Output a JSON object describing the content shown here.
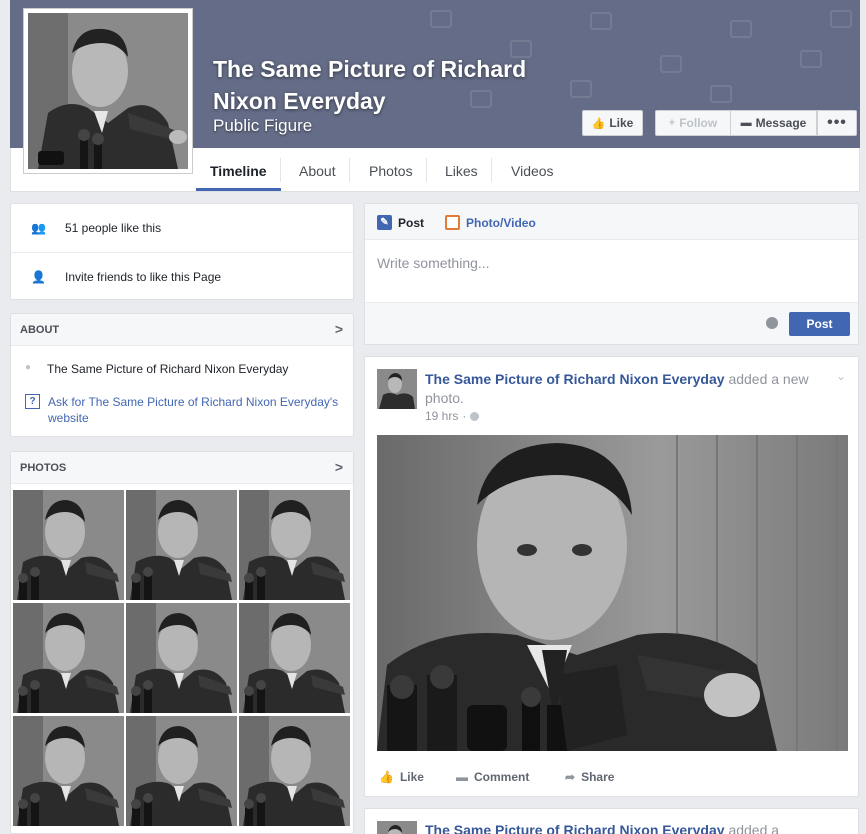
{
  "page": {
    "name": "The Same Picture of Richard Nixon Everyday",
    "category": "Public Figure"
  },
  "header_buttons": {
    "like": "Like",
    "follow": "Follow",
    "message": "Message",
    "more": "•••"
  },
  "tabs": [
    {
      "label": "Timeline",
      "active": true
    },
    {
      "label": "About"
    },
    {
      "label": "Photos"
    },
    {
      "label": "Likes"
    },
    {
      "label": "Videos"
    }
  ],
  "left": {
    "likes_count": "51 people like this",
    "invite": "Invite friends to like this Page",
    "about": {
      "heading": "ABOUT",
      "description": "The Same Picture of Richard Nixon Everyday",
      "website_prompt": "Ask for The Same Picture of Richard Nixon Everyday's website"
    },
    "photos": {
      "heading": "PHOTOS",
      "count": 9
    }
  },
  "composer": {
    "tab_post": "Post",
    "tab_photo": "Photo/Video",
    "placeholder": "Write something...",
    "submit": "Post"
  },
  "posts": [
    {
      "author": "The Same Picture of Richard Nixon Everyday",
      "action": "added a new photo.",
      "time": "19 hrs",
      "actions": [
        "Like",
        "Comment",
        "Share"
      ]
    },
    {
      "author": "The Same Picture of Richard Nixon Everyday",
      "action": "added a"
    }
  ],
  "colors": {
    "cover": "#646c87",
    "link": "#365899",
    "primary_button": "#4267b2",
    "background": "#e9ebee"
  }
}
